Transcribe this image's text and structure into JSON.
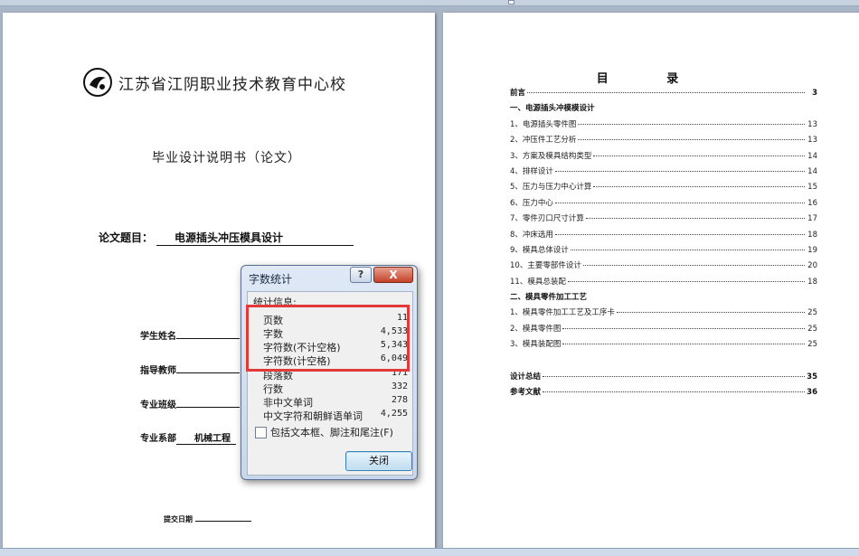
{
  "left_page": {
    "school_name": "江苏省江阴职业技术教育中心校",
    "doc_type": "毕业设计说明书（论文）",
    "topic_label": "论文题目：",
    "topic_value": "电源插头冲压模具设计",
    "fields": [
      {
        "label": "学生姓名",
        "value": ""
      },
      {
        "label": "指导教师",
        "value": ""
      },
      {
        "label": "专业班级",
        "value": ""
      },
      {
        "label": "专业系部",
        "value": "机械工程"
      }
    ],
    "submit_label": "提交日期"
  },
  "right_page": {
    "toc_title": "目 录",
    "toc": [
      {
        "label": "前言",
        "page": "3",
        "bold": true
      },
      {
        "label": "一、电源插头冲模模设计",
        "page": "",
        "head": true
      },
      {
        "label": "1、电源插头零件图",
        "page": "13"
      },
      {
        "label": "2、冲压件工艺分析",
        "page": "13"
      },
      {
        "label": "3、方案及模具结构类型",
        "page": "14"
      },
      {
        "label": "4、排样设计",
        "page": "14"
      },
      {
        "label": "5、压力与压力中心计算",
        "page": "15"
      },
      {
        "label": "6、压力中心",
        "page": "16"
      },
      {
        "label": "7、零件刃口尺寸计算",
        "page": "17"
      },
      {
        "label": "8、冲床选用",
        "page": "18"
      },
      {
        "label": "9、模具总体设计",
        "page": "19"
      },
      {
        "label": "10、主要零部件设计",
        "page": "20"
      },
      {
        "label": "11、模具总装配",
        "page": "18"
      },
      {
        "label": "二、模具零件加工工艺",
        "page": "",
        "head": true
      },
      {
        "label": "1、模具零件加工工艺及工序卡",
        "page": "25"
      },
      {
        "label": "2、模具零件图",
        "page": "25"
      },
      {
        "label": "3、模具装配图",
        "page": "25"
      },
      {
        "label": "",
        "page": "",
        "gap": true
      },
      {
        "label": "设计总结",
        "page": "35",
        "bold": true
      },
      {
        "label": "参考文献",
        "page": "36",
        "bold": true
      }
    ]
  },
  "dialog": {
    "title": "字数统计",
    "help_label": "?",
    "close_label": "X",
    "stats_caption": "统计信息:",
    "stats": [
      {
        "label": "页数",
        "value": "11"
      },
      {
        "label": "字数",
        "value": "4,533"
      },
      {
        "label": "字符数(不计空格)",
        "value": "5,343"
      },
      {
        "label": "字符数(计空格)",
        "value": "6,049"
      },
      {
        "label": "段落数",
        "value": "171"
      },
      {
        "label": "行数",
        "value": "332"
      },
      {
        "label": "非中文单词",
        "value": "278"
      },
      {
        "label": "中文字符和朝鲜语单词",
        "value": "4,255"
      }
    ],
    "checkbox_label": "包括文本框、脚注和尾注(F)",
    "close_button_label": "关闭"
  },
  "colors": {
    "highlight": "#e23a3a",
    "workspace": "#a9b6c8"
  }
}
